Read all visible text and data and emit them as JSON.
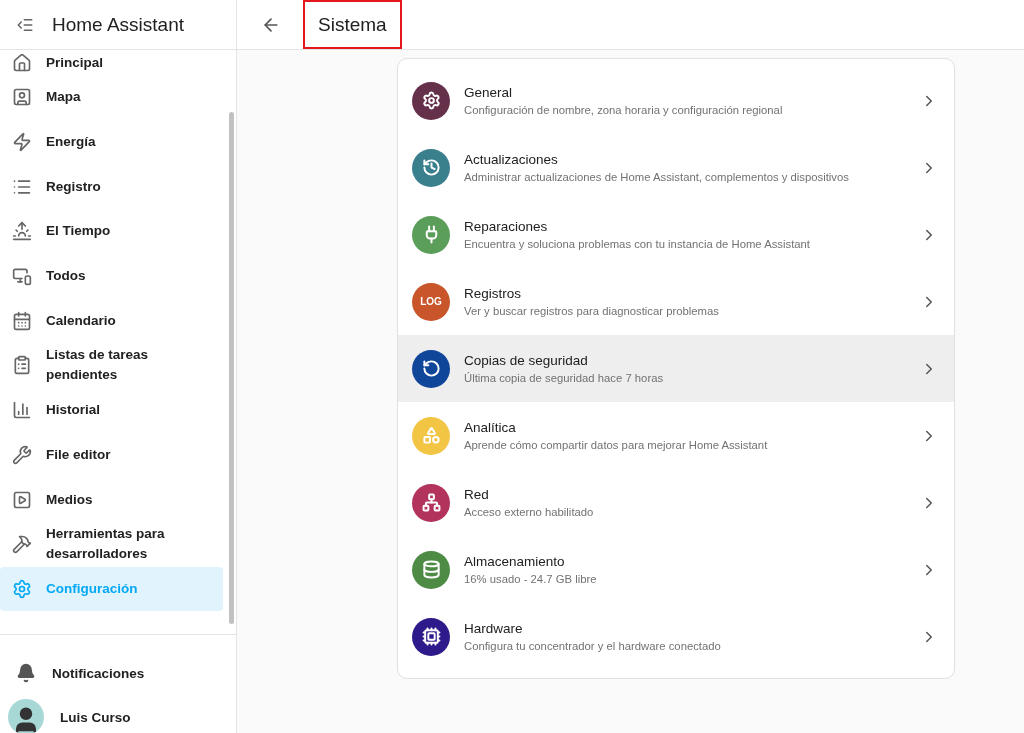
{
  "sidebar": {
    "title": "Home Assistant",
    "items": [
      {
        "label": "Principal",
        "selected": false
      },
      {
        "label": "Mapa",
        "selected": false
      },
      {
        "label": "Energía",
        "selected": false
      },
      {
        "label": "Registro",
        "selected": false
      },
      {
        "label": "El Tiempo",
        "selected": false
      },
      {
        "label": "Todos",
        "selected": false
      },
      {
        "label": "Calendario",
        "selected": false
      },
      {
        "label": "Listas de tareas pendientes",
        "selected": false
      },
      {
        "label": "Historial",
        "selected": false
      },
      {
        "label": "File editor",
        "selected": false
      },
      {
        "label": "Medios",
        "selected": false
      },
      {
        "label": "Herramientas para desarrolladores",
        "selected": false
      },
      {
        "label": "Configuración",
        "selected": true
      }
    ],
    "notifications": "Notificaciones",
    "user": "Luis Curso"
  },
  "page": {
    "title": "Sistema",
    "title_highlighted": true
  },
  "rows": [
    {
      "title": "General",
      "subtitle": "Configuración de nombre, zona horaria y configuración regional",
      "color": "#64304a",
      "hovered": false
    },
    {
      "title": "Actualizaciones",
      "subtitle": "Administrar actualizaciones de Home Assistant, complementos y dispositivos",
      "color": "#3a7f8c",
      "hovered": false
    },
    {
      "title": "Reparaciones",
      "subtitle": "Encuentra y soluciona problemas con tu instancia de Home Assistant",
      "color": "#5a9e5a",
      "hovered": false
    },
    {
      "title": "Registros",
      "subtitle": "Ver y buscar registros para diagnosticar problemas",
      "color": "#c9552b",
      "hovered": false,
      "badge": "LOG"
    },
    {
      "title": "Copias de seguridad",
      "subtitle": "Última copia de seguridad hace 7 horas",
      "color": "#0f4699",
      "hovered": true
    },
    {
      "title": "Analítica",
      "subtitle": "Aprende cómo compartir datos para mejorar Home Assistant",
      "color": "#f2c545",
      "hovered": false
    },
    {
      "title": "Red",
      "subtitle": "Acceso externo habilitado",
      "color": "#b2335c",
      "hovered": false
    },
    {
      "title": "Almacenamiento",
      "subtitle": "16% usado - 24.7 GB libre",
      "color": "#4e8c46",
      "hovered": false
    },
    {
      "title": "Hardware",
      "subtitle": "Configura tu concentrador y el hardware conectado",
      "color": "#2f1a8c",
      "hovered": false
    }
  ]
}
